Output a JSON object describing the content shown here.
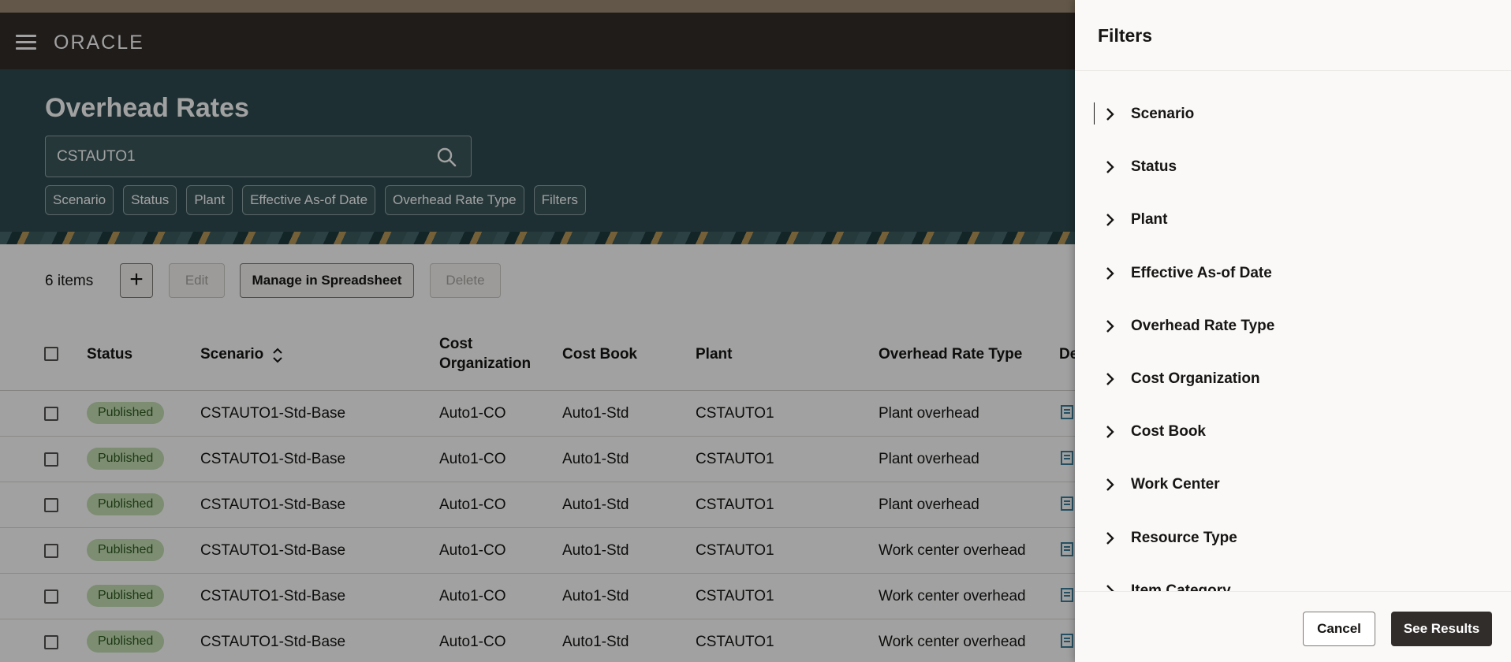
{
  "header": {
    "logo": "ORACLE"
  },
  "page": {
    "title": "Overhead Rates",
    "search": {
      "value": "CSTAUTO1"
    },
    "chips": [
      "Scenario",
      "Status",
      "Plant",
      "Effective As-of Date",
      "Overhead Rate Type",
      "Filters"
    ]
  },
  "toolbar": {
    "count": "6 items",
    "add_label": "+",
    "edit_label": "Edit",
    "spreadsheet_label": "Manage in Spreadsheet",
    "delete_label": "Delete"
  },
  "table": {
    "columns": {
      "status": "Status",
      "scenario": "Scenario",
      "cost_org_1": "Cost",
      "cost_org_2": "Organization",
      "cost_book": "Cost Book",
      "plant": "Plant",
      "rate_type": "Overhead Rate Type",
      "desc": "De"
    },
    "rows": [
      {
        "status": "Published",
        "scenario": "CSTAUTO1-Std-Base",
        "cost_org": "Auto1-CO",
        "cost_book": "Auto1-Std",
        "plant": "CSTAUTO1",
        "rate_type": "Plant overhead"
      },
      {
        "status": "Published",
        "scenario": "CSTAUTO1-Std-Base",
        "cost_org": "Auto1-CO",
        "cost_book": "Auto1-Std",
        "plant": "CSTAUTO1",
        "rate_type": "Plant overhead"
      },
      {
        "status": "Published",
        "scenario": "CSTAUTO1-Std-Base",
        "cost_org": "Auto1-CO",
        "cost_book": "Auto1-Std",
        "plant": "CSTAUTO1",
        "rate_type": "Plant overhead"
      },
      {
        "status": "Published",
        "scenario": "CSTAUTO1-Std-Base",
        "cost_org": "Auto1-CO",
        "cost_book": "Auto1-Std",
        "plant": "CSTAUTO1",
        "rate_type": "Work center overhead"
      },
      {
        "status": "Published",
        "scenario": "CSTAUTO1-Std-Base",
        "cost_org": "Auto1-CO",
        "cost_book": "Auto1-Std",
        "plant": "CSTAUTO1",
        "rate_type": "Work center overhead"
      },
      {
        "status": "Published",
        "scenario": "CSTAUTO1-Std-Base",
        "cost_org": "Auto1-CO",
        "cost_book": "Auto1-Std",
        "plant": "CSTAUTO1",
        "rate_type": "Work center overhead"
      }
    ]
  },
  "drawer": {
    "title": "Filters",
    "filters": [
      "Scenario",
      "Status",
      "Plant",
      "Effective As-of Date",
      "Overhead Rate Type",
      "Cost Organization",
      "Cost Book",
      "Work Center",
      "Resource Type",
      "Item Category"
    ],
    "cancel_label": "Cancel",
    "results_label": "See Results"
  },
  "colors": {
    "topbar": "#312d2a",
    "hero": "#2e4b50",
    "badge_bg": "#c5e0b4",
    "badge_text": "#2e5a1f",
    "primary_button": "#312d2a"
  }
}
